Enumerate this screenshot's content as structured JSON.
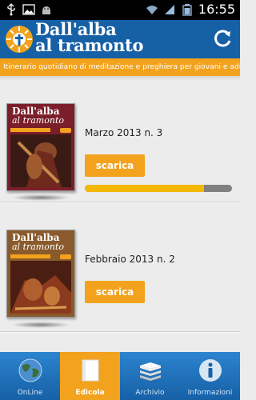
{
  "status_bar": {
    "time": "16:55"
  },
  "header": {
    "title_line1": "Dall'alba",
    "title_line2": "al tramonto",
    "refresh_icon": "refresh-icon"
  },
  "subtitle": "Itinerario quotidiano di meditazione e preghiera per giovani e adulti",
  "issues": [
    {
      "title": "Marzo 2013 n. 3",
      "button_label": "scarica",
      "download_progress": 0.81,
      "cover": {
        "title_line1": "Dall'alba",
        "title_line2": "al tramonto"
      }
    },
    {
      "title": "Febbraio 2013 n. 2",
      "button_label": "scarica",
      "cover": {
        "title_line1": "Dall'alba",
        "title_line2": "al tramonto"
      }
    }
  ],
  "bottom_nav": {
    "tabs": [
      {
        "label": "OnLine",
        "icon": "globe-icon",
        "active": false
      },
      {
        "label": "Edicola",
        "icon": "book-icon",
        "active": true
      },
      {
        "label": "Archivio",
        "icon": "stack-icon",
        "active": false
      },
      {
        "label": "Informazioni",
        "icon": "info-icon",
        "active": false
      }
    ]
  },
  "colors": {
    "brand_blue": "#1660a6",
    "accent_orange": "#f2a21d",
    "progress_fill": "#f5b800"
  }
}
